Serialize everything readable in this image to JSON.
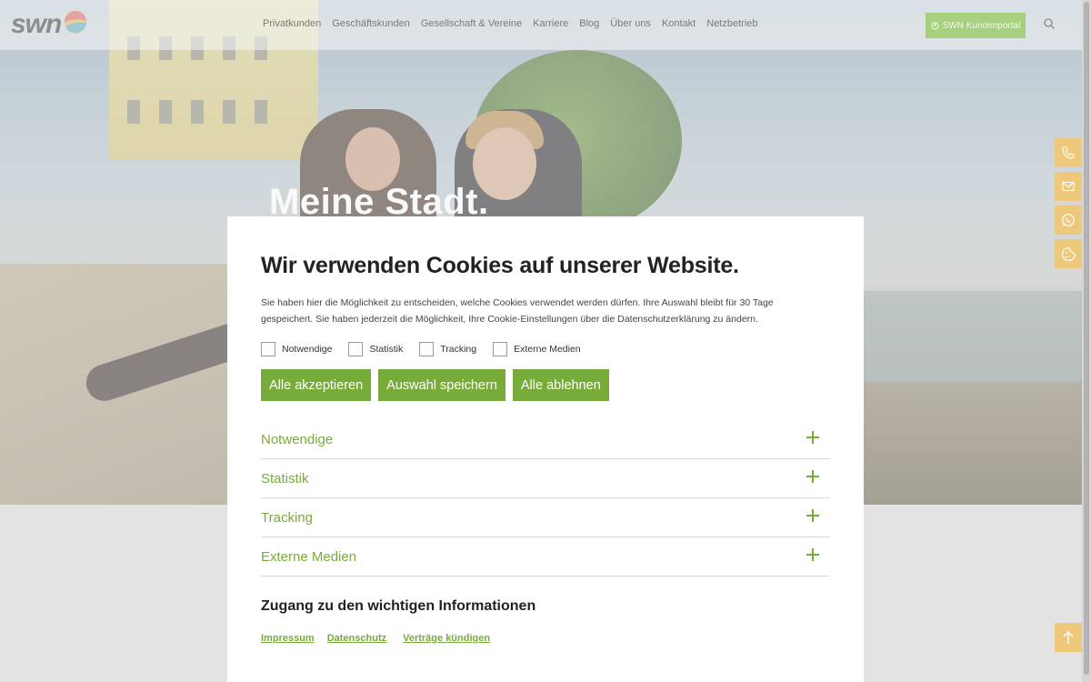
{
  "header": {
    "logo_text": "swn",
    "nav": [
      "Privatkunden",
      "Geschäftskunden",
      "Gesellschaft & Vereine",
      "Karriere",
      "Blog",
      "Über uns",
      "Kontakt",
      "Netzbetrieb"
    ],
    "portal_label": "SWN Kundenportal"
  },
  "hero": {
    "title": "Meine Stadt."
  },
  "side_actions": [
    "phone-icon",
    "mail-icon",
    "whatsapp-icon",
    "cookie-icon"
  ],
  "cookie_modal": {
    "title": "Wir verwenden Cookies auf unserer Website.",
    "description": "Sie haben hier die Möglichkeit zu entscheiden, welche Cookies verwendet werden dürfen. Ihre Auswahl bleibt für 30 Tage gespeichert. Sie haben jederzeit die Möglichkeit, Ihre Cookie-Einstellungen über die Datenschutzerklärung zu ändern.",
    "checkboxes": [
      {
        "label": "Notwendige",
        "checked": false
      },
      {
        "label": "Statistik",
        "checked": false
      },
      {
        "label": "Tracking",
        "checked": false
      },
      {
        "label": "Externe Medien",
        "checked": false
      }
    ],
    "buttons": {
      "accept_all": "Alle akzeptieren",
      "save_selection": "Auswahl speichern",
      "reject_all": "Alle ablehnen"
    },
    "accordion": [
      "Notwendige",
      "Statistik",
      "Tracking",
      "Externe Medien"
    ],
    "info_title": "Zugang zu den wichtigen Informationen",
    "links": [
      "Impressum",
      "Datenschutz",
      "Verträge kündigen"
    ]
  },
  "colors": {
    "accent_green": "#78ac3a",
    "side_button": "#eec97c"
  }
}
